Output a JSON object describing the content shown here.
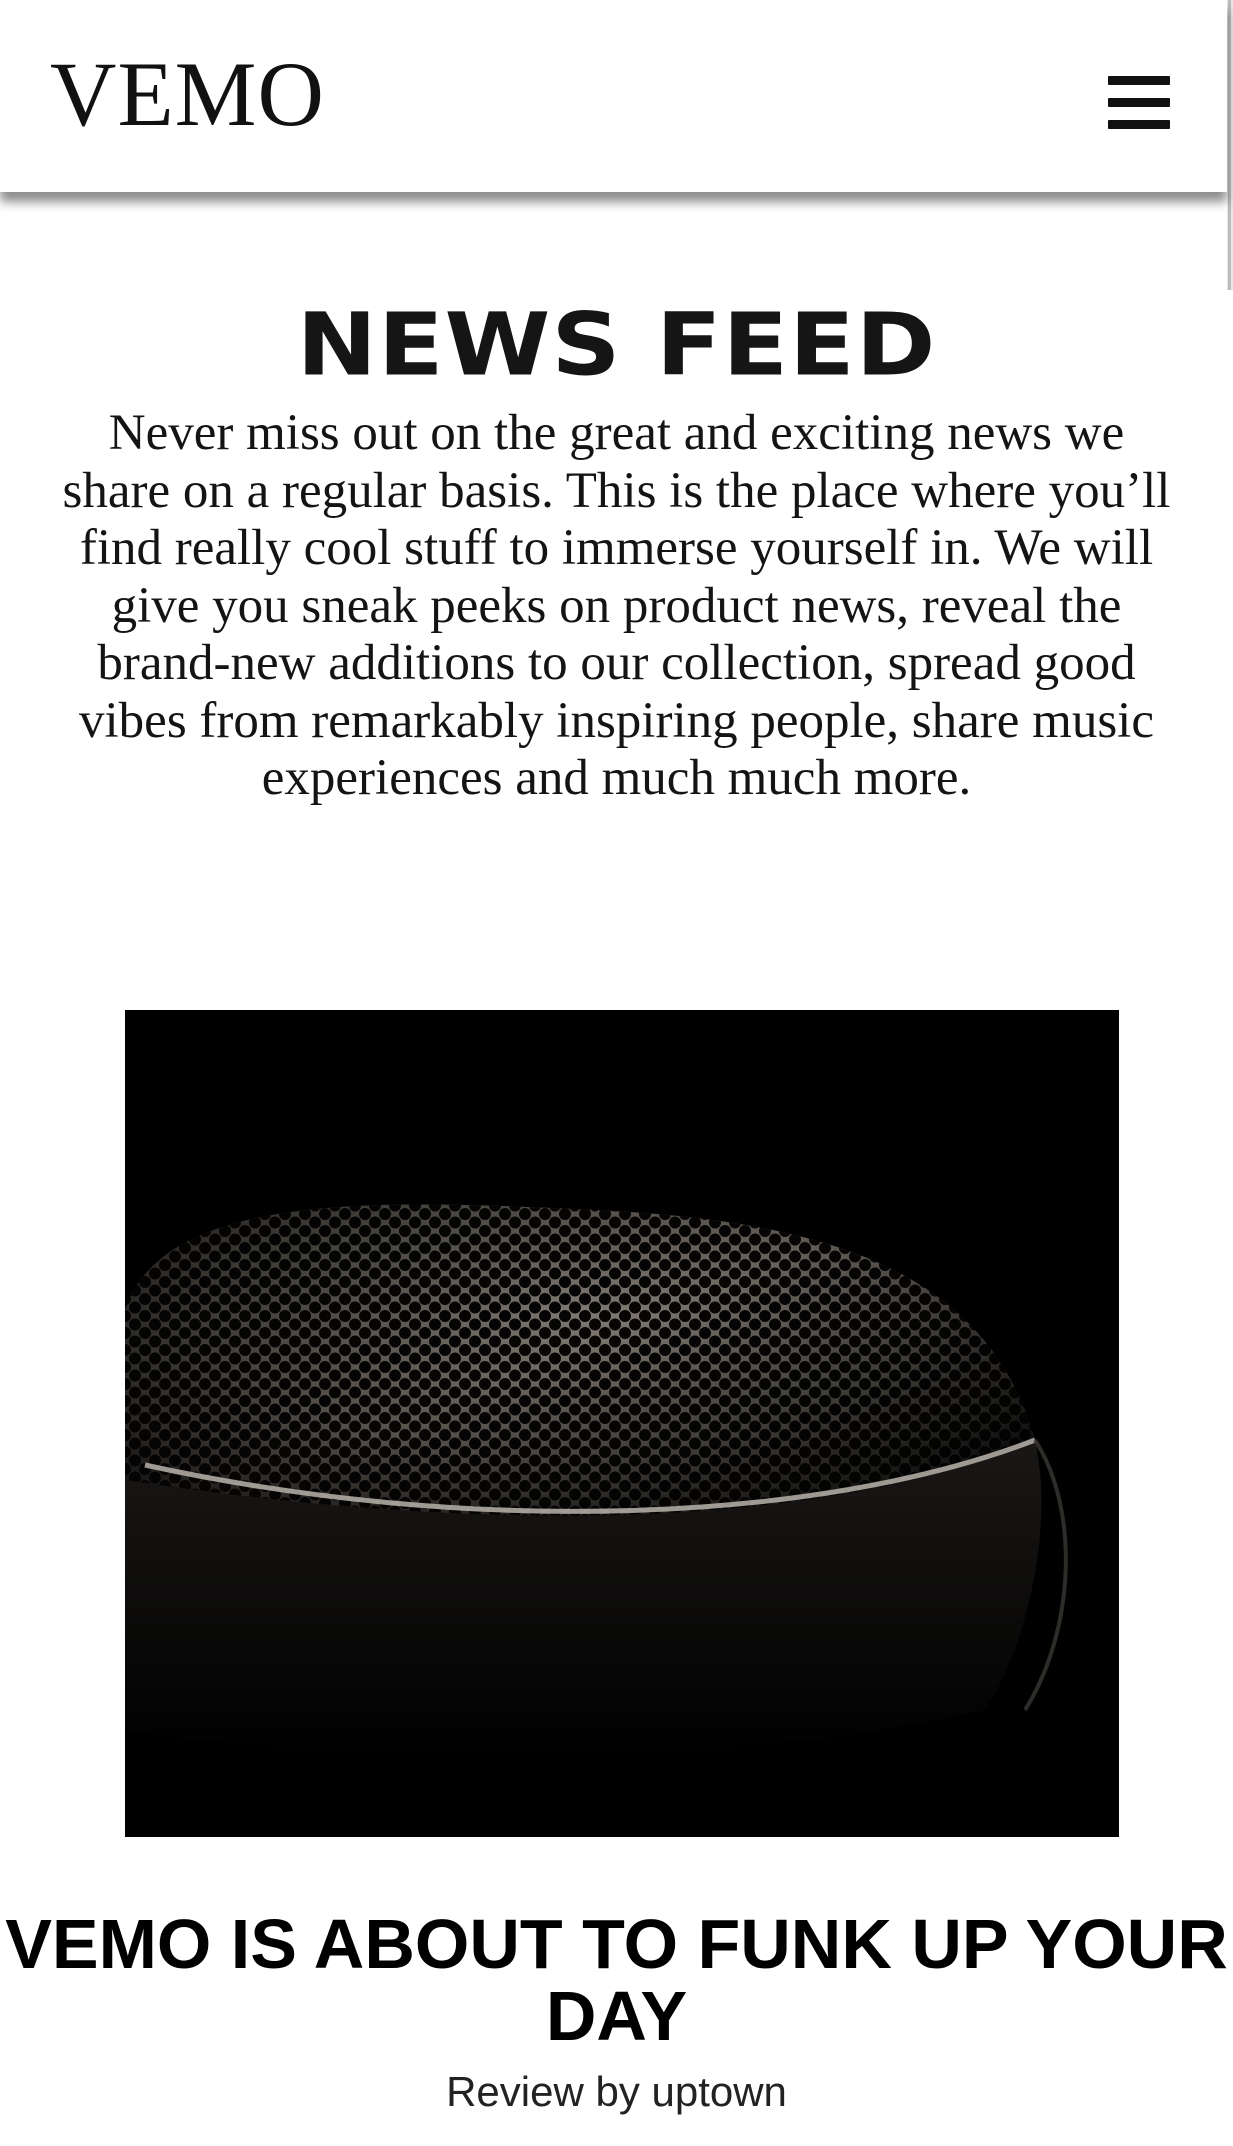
{
  "header": {
    "logo": "VEMO",
    "menu_icon": "hamburger-menu-icon"
  },
  "news_feed": {
    "title": "NEWS FEED",
    "intro": "Never miss out on the great and exciting news we share on a regular basis. This is the place where you’ll find really cool stuff to immerse yourself in. We will give you sneak peeks on product news, reveal the brand-new additions to our collection, spread good vibes from remarkably inspiring people, share music experiences and much much more."
  },
  "article": {
    "image_subject": "speaker-grille-closeup",
    "title": "VEMO IS ABOUT TO FUNK UP YOUR DAY",
    "byline": "Review by uptown"
  }
}
